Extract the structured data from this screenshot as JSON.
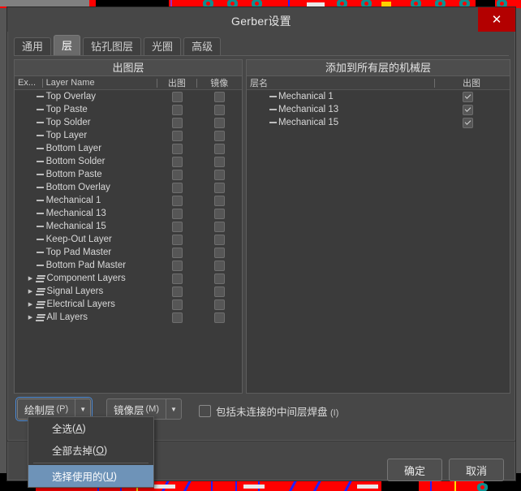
{
  "window": {
    "title": "Gerber设置",
    "close_label": "✕"
  },
  "tabs": [
    {
      "label": "通用",
      "active": false
    },
    {
      "label": "层",
      "active": true
    },
    {
      "label": "钻孔图层",
      "active": false
    },
    {
      "label": "光圈",
      "active": false
    },
    {
      "label": "高级",
      "active": false
    }
  ],
  "left_panel": {
    "title": "出图层",
    "columns": [
      "Ex...",
      "Layer Name",
      "出图",
      "镜像"
    ],
    "rows": [
      {
        "name": "Top Overlay",
        "type": "layer",
        "plot": false,
        "mirror": false
      },
      {
        "name": "Top Paste",
        "type": "layer",
        "plot": false,
        "mirror": false
      },
      {
        "name": "Top Solder",
        "type": "layer",
        "plot": false,
        "mirror": false
      },
      {
        "name": "Top Layer",
        "type": "layer",
        "plot": false,
        "mirror": false
      },
      {
        "name": "Bottom Layer",
        "type": "layer",
        "plot": false,
        "mirror": false
      },
      {
        "name": "Bottom Solder",
        "type": "layer",
        "plot": false,
        "mirror": false
      },
      {
        "name": "Bottom Paste",
        "type": "layer",
        "plot": false,
        "mirror": false
      },
      {
        "name": "Bottom Overlay",
        "type": "layer",
        "plot": false,
        "mirror": false
      },
      {
        "name": "Mechanical 1",
        "type": "layer",
        "plot": false,
        "mirror": false
      },
      {
        "name": "Mechanical 13",
        "type": "layer",
        "plot": false,
        "mirror": false
      },
      {
        "name": "Mechanical 15",
        "type": "layer",
        "plot": false,
        "mirror": false
      },
      {
        "name": "Keep-Out Layer",
        "type": "layer",
        "plot": false,
        "mirror": false
      },
      {
        "name": "Top Pad Master",
        "type": "layer",
        "plot": false,
        "mirror": false
      },
      {
        "name": "Bottom Pad Master",
        "type": "layer",
        "plot": false,
        "mirror": false
      },
      {
        "name": "Component Layers",
        "type": "group",
        "plot": false,
        "mirror": false
      },
      {
        "name": "Signal Layers",
        "type": "group",
        "plot": false,
        "mirror": false
      },
      {
        "name": "Electrical Layers",
        "type": "group",
        "plot": false,
        "mirror": false
      },
      {
        "name": "All Layers",
        "type": "group",
        "plot": false,
        "mirror": false
      }
    ]
  },
  "right_panel": {
    "title": "添加到所有层的机械层",
    "columns": [
      "层名",
      "出图"
    ],
    "rows": [
      {
        "name": "Mechanical 1",
        "plot": true
      },
      {
        "name": "Mechanical 13",
        "plot": true
      },
      {
        "name": "Mechanical 15",
        "plot": true
      }
    ]
  },
  "controls": {
    "plot_layers": {
      "label": "绘制层",
      "accel": "(P)",
      "focused": true
    },
    "mirror_layers": {
      "label": "镜像层",
      "accel": "(M)",
      "focused": false
    },
    "include_pads": {
      "label": "包括未连接的中间层焊盘",
      "accel": "(I)",
      "checked": false
    }
  },
  "dropdown_menu": {
    "open": true,
    "items": [
      {
        "label": "全选",
        "accel": "A",
        "selected": false,
        "separator_after": false
      },
      {
        "label": "全部去掉",
        "accel": "O",
        "selected": false,
        "separator_after": true
      },
      {
        "label": "选择使用的",
        "accel": "U",
        "selected": true,
        "separator_after": false
      }
    ]
  },
  "footer": {
    "ok_label": "确定",
    "cancel_label": "取消"
  },
  "colors": {
    "dialog_bg": "#474747",
    "list_bg": "#3b3b3b",
    "close_btn": "#b30000",
    "menu_highlight": "#6e93b8",
    "focus_ring": "#4b8ad6",
    "pcb_red": "#ff0000",
    "pcb_pad": "#0f8f8f",
    "pcb_trace_blue": "#2020ff"
  }
}
